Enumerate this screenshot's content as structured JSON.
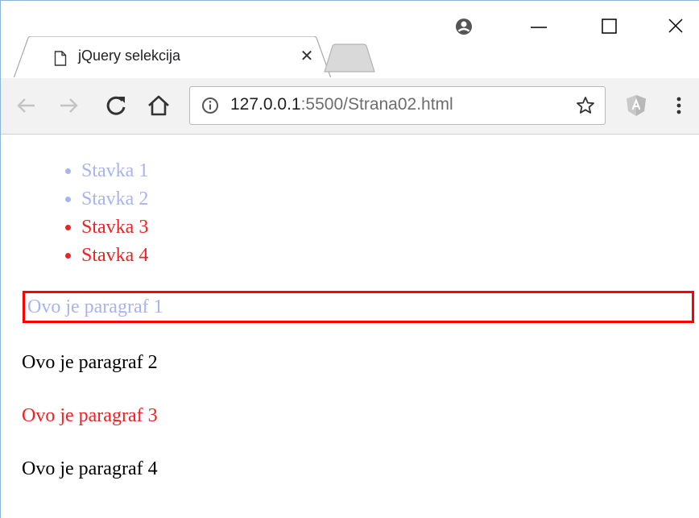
{
  "browser": {
    "tab": {
      "title": "jQuery selekcija",
      "close_glyph": "✕"
    },
    "address_bar": {
      "host": "127.0.0.1",
      "path": ":5500/Strana02.html"
    },
    "icons": {
      "tab": "document-icon",
      "profile": "account-icon",
      "minimize": "minimize-icon",
      "maximize": "maximize-icon",
      "close": "close-icon",
      "back": "back-arrow-icon",
      "forward": "forward-arrow-icon",
      "reload": "reload-icon",
      "home": "home-icon",
      "info": "info-icon",
      "bookmark": "star-icon",
      "extension": "angular-extension-icon",
      "menu": "more-vertical-icon"
    }
  },
  "page": {
    "list": [
      {
        "text": "Stavka 1",
        "color": "#a6b4f4"
      },
      {
        "text": "Stavka 2",
        "color": "#a6b4f4"
      },
      {
        "text": "Stavka 3",
        "color": "#ee2222"
      },
      {
        "text": "Stavka 4",
        "color": "#ee2222"
      }
    ],
    "paragraphs": [
      {
        "text": "Ovo je paragraf 1",
        "color": "#a6b4f4",
        "outlined": true
      },
      {
        "text": "Ovo je paragraf 2",
        "color": "#000000",
        "outlined": false
      },
      {
        "text": "Ovo je paragraf 3",
        "color": "#ee2222",
        "outlined": false
      },
      {
        "text": "Ovo je paragraf 4",
        "color": "#000000",
        "outlined": false
      }
    ],
    "outline_color": "#ff0000"
  }
}
